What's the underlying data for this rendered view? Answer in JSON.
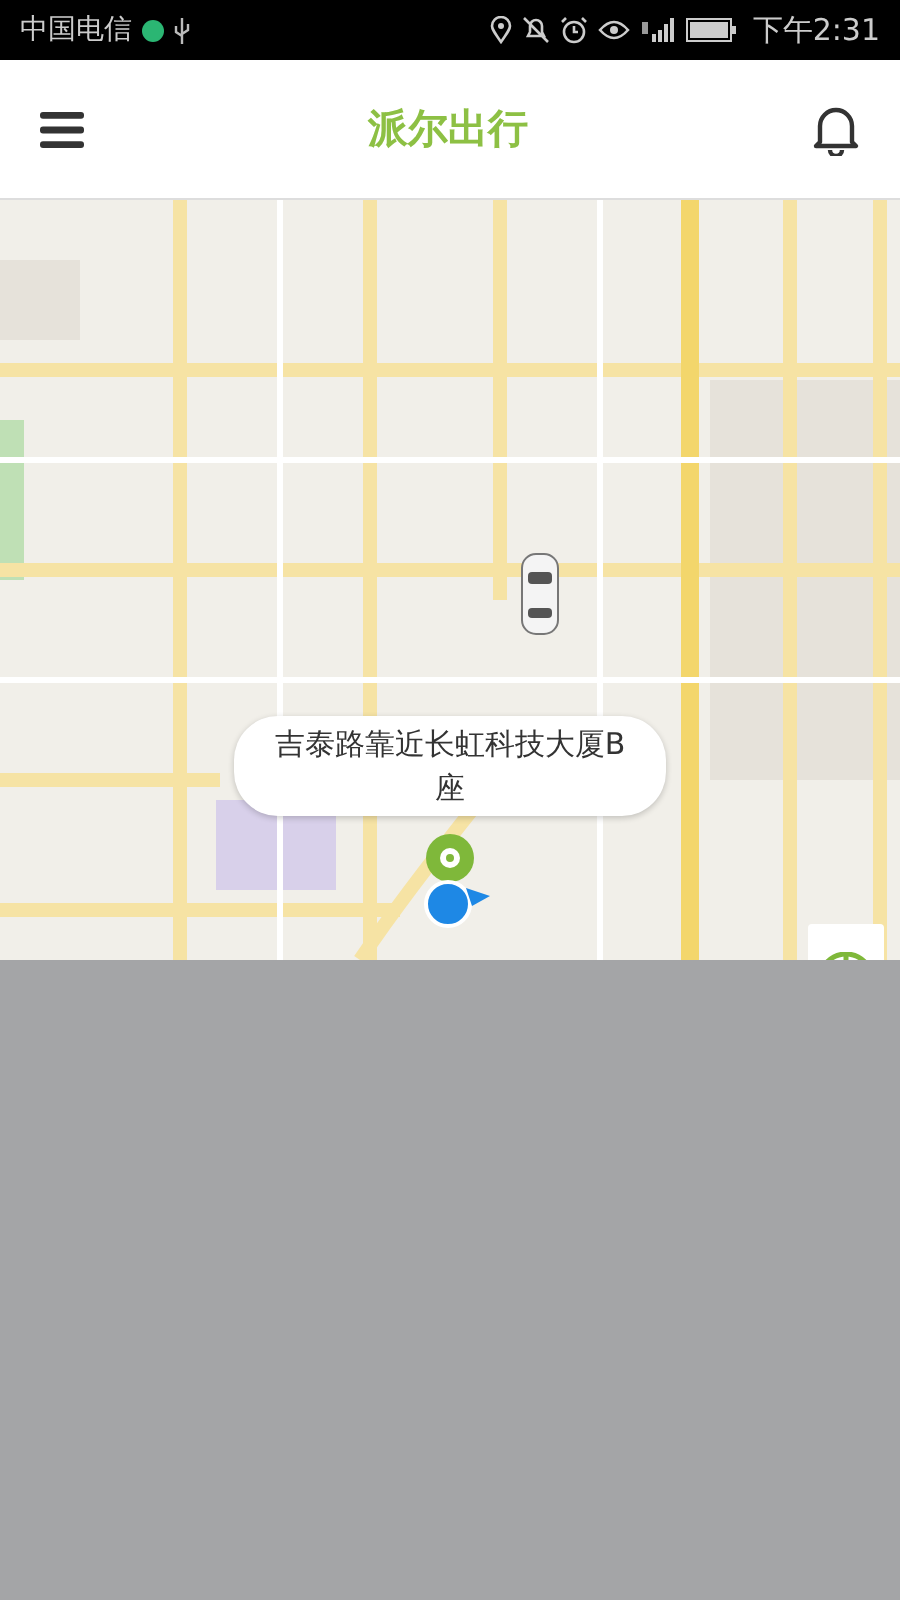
{
  "status_bar": {
    "carrier": "中国电信",
    "time": "下午2:31"
  },
  "header": {
    "title": "派尔出行"
  },
  "map": {
    "address_bubble": "吉泰路靠近长虹科技大厦B座"
  }
}
